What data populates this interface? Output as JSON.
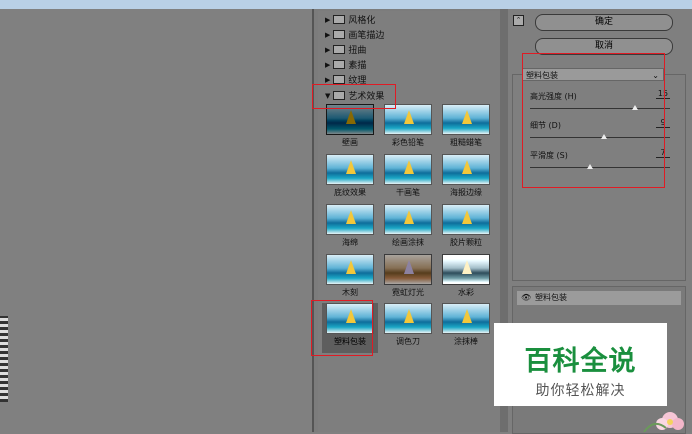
{
  "categories": [
    {
      "label": "风格化"
    },
    {
      "label": "画笔描边"
    },
    {
      "label": "扭曲"
    },
    {
      "label": "素描"
    },
    {
      "label": "纹理"
    },
    {
      "label": "艺术效果"
    }
  ],
  "filters": [
    {
      "label": "壁画",
      "style": "dark"
    },
    {
      "label": "彩色铅笔",
      "style": ""
    },
    {
      "label": "粗糙蜡笔",
      "style": ""
    },
    {
      "label": "底纹效果",
      "style": ""
    },
    {
      "label": "干画笔",
      "style": ""
    },
    {
      "label": "海报边缘",
      "style": ""
    },
    {
      "label": "海绵",
      "style": ""
    },
    {
      "label": "绘画涂抹",
      "style": ""
    },
    {
      "label": "胶片颗粒",
      "style": ""
    },
    {
      "label": "木刻",
      "style": ""
    },
    {
      "label": "霓虹灯光",
      "style": "purple"
    },
    {
      "label": "水彩",
      "style": "gray"
    },
    {
      "label": "塑料包装",
      "style": ""
    },
    {
      "label": "调色刀",
      "style": ""
    },
    {
      "label": "涂抹棒",
      "style": ""
    }
  ],
  "buttons": {
    "ok": "确定",
    "cancel": "取消"
  },
  "effect_select": {
    "value": "塑料包装"
  },
  "sliders": [
    {
      "label": "高光强度 (H)",
      "value": "15",
      "fraction": 0.75
    },
    {
      "label": "细节 (D)",
      "value": "9",
      "fraction": 0.53
    },
    {
      "label": "平滑度 (S)",
      "value": "7",
      "fraction": 0.43
    }
  ],
  "layer": {
    "label": "塑料包装"
  },
  "watermark": {
    "title": "百科全说",
    "subtitle": "助你轻松解决"
  },
  "colors": {
    "highlight": "#e01b24",
    "watermark_green": "#1a8f3e"
  }
}
